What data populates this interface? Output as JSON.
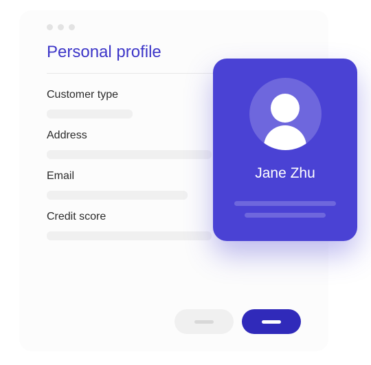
{
  "window": {
    "title": "Personal profile",
    "fields": [
      {
        "label": "Customer type"
      },
      {
        "label": "Address"
      },
      {
        "label": "Email"
      },
      {
        "label": "Credit score"
      }
    ]
  },
  "profile": {
    "name": "Jane Zhu"
  }
}
